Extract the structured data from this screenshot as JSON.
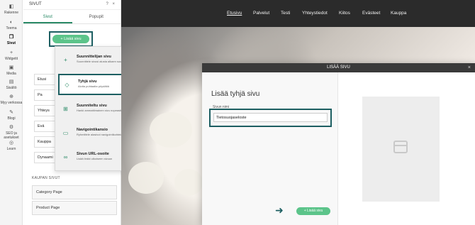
{
  "rail": {
    "items": [
      {
        "label": "Rakenne",
        "icon": "layers-icon"
      },
      {
        "label": "Teema",
        "icon": "palette-icon"
      },
      {
        "label": "Sivut",
        "icon": "pages-icon"
      },
      {
        "label": "Widgetit",
        "icon": "plus-icon"
      },
      {
        "label": "Media",
        "icon": "image-icon"
      },
      {
        "label": "Sisältö",
        "icon": "content-icon"
      },
      {
        "label": "Myy verkossa",
        "icon": "store-icon"
      },
      {
        "label": "Blogi",
        "icon": "blog-icon"
      },
      {
        "label": "SEO ja asetukset",
        "icon": "settings-icon"
      },
      {
        "label": "Learn",
        "icon": "learn-icon"
      }
    ]
  },
  "panel": {
    "title": "SIVUT",
    "tabs": [
      "Sivut",
      "Popupit"
    ],
    "add_button": "+ Lisää sivu",
    "pages": [
      "Etusi",
      "Pa",
      "Yhteys",
      "Evä",
      "Kauppa",
      "Dynaami"
    ],
    "shop_section_label": "KAUPAN SIVUT",
    "shop_pages": [
      "Category Page",
      "Product Page"
    ]
  },
  "dropdown": {
    "items": [
      {
        "title": "Suunnittelijan sivu",
        "desc": "Suunnittele sivusi alusta alkaen suunnittelijan sivupohjalla",
        "icon": "plus-icon"
      },
      {
        "title": "Tyhjä sivu",
        "desc": "Aloita puhtaalta pöydältä",
        "icon": "blank-page-icon"
      },
      {
        "title": "Suunniteltu sivu",
        "desc": "Hanki ammattimainen sivu nopeasti",
        "icon": "grid-icon"
      },
      {
        "title": "Navigointikansio",
        "desc": "Ryhmittele alasivut navigointikohteiden alle",
        "icon": "folder-icon"
      },
      {
        "title": "Sivun URL-osoite",
        "desc": "Lisää linkki ulkoiseen sivuun",
        "icon": "link-icon"
      }
    ]
  },
  "site": {
    "nav": [
      "Etusivu",
      "Palvelut",
      "Testi",
      "Yhteystiedot",
      "Kiitos",
      "Evästeet",
      "Kauppa"
    ]
  },
  "modal": {
    "header": "LISÄÄ SIVU",
    "title": "Lisää tyhjä sivu",
    "field_label": "Sivun nimi",
    "field_value": "Tietosuojaseloste",
    "add_button": "+ Lisää sivu"
  }
}
